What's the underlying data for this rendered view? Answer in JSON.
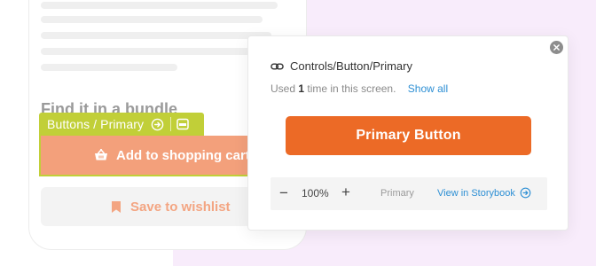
{
  "left_panel": {
    "heading": "Find it in a bundle",
    "component_tag": {
      "label": "Buttons / Primary"
    },
    "primary_button": {
      "label": "Add to shopping cart"
    },
    "wishlist_button": {
      "label": "Save to wishlist"
    }
  },
  "popup": {
    "title": "Controls/Button/Primary",
    "usage_prefix": "Used",
    "usage_count": "1",
    "usage_suffix": "time in this screen.",
    "show_all": "Show all",
    "preview_button_label": "Primary Button",
    "toolbar": {
      "zoom_out": "−",
      "zoom_value": "100%",
      "zoom_in": "+",
      "variant": "Primary",
      "storybook_link": "View in Storybook"
    }
  },
  "colors": {
    "accent_orange": "#ec6a26",
    "highlight_green": "#c1cf38",
    "link_blue": "#2d8fd4"
  },
  "icons": [
    "close-icon",
    "link-icon",
    "cart-icon",
    "bookmark-icon",
    "arrow-right-circle-icon",
    "component-icon"
  ]
}
